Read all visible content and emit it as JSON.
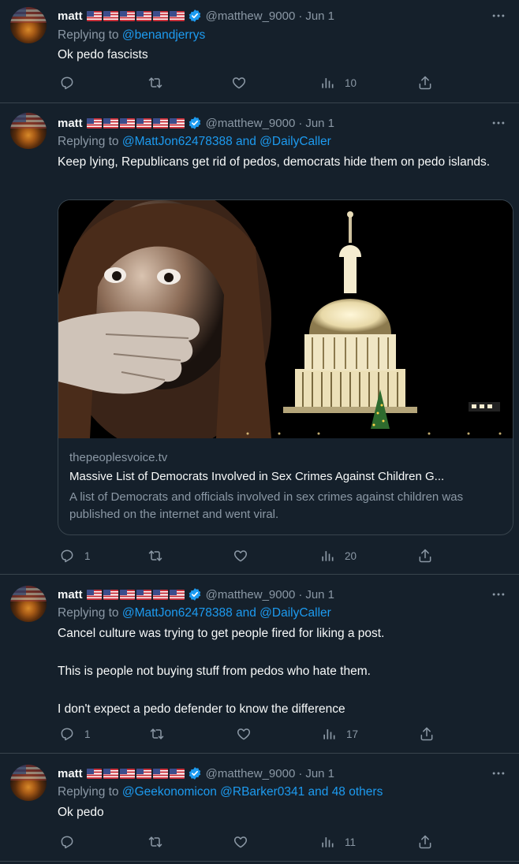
{
  "colors": {
    "background": "#15202b",
    "divider": "#38444d",
    "link": "#1d9bf0",
    "muted": "#8b98a5",
    "text": "#f7f9f9"
  },
  "icons": [
    "reply-icon",
    "retweet-icon",
    "like-icon",
    "views-icon",
    "share-icon",
    "verified-badge-icon",
    "more-icon"
  ],
  "tweets": [
    {
      "name": "matt",
      "handle": "@matthew_9000",
      "dot": "·",
      "date": "Jun 1",
      "reply_prefix": "Replying to ",
      "reply_to": "@benandjerrys",
      "text": "Ok pedo fascists",
      "reply_count": "",
      "views": "10"
    },
    {
      "name": "matt",
      "handle": "@matthew_9000",
      "dot": "·",
      "date": "Jun 1",
      "reply_prefix": "Replying to ",
      "reply_to": "@MattJon62478388 and @DailyCaller",
      "text": "Keep lying, Republicans get rid of pedos, democrats hide them on pedo islands.",
      "card": {
        "domain": "thepeoplesvoice.tv",
        "title": "Massive List of Democrats Involved in Sex Crimes Against Children G...",
        "description": "A list of Democrats and officials involved in sex crimes against children was published on the internet and went viral."
      },
      "reply_count": "1",
      "views": "20"
    },
    {
      "name": "matt",
      "handle": "@matthew_9000",
      "dot": "·",
      "date": "Jun 1",
      "reply_prefix": "Replying to ",
      "reply_to": "@MattJon62478388 and @DailyCaller",
      "text": "Cancel culture was trying to get people fired for liking a post.\n\nThis is people not buying stuff from pedos who hate them.\n\nI don't expect a pedo defender to know the difference",
      "reply_count": "1",
      "views": "17"
    },
    {
      "name": "matt",
      "handle": "@matthew_9000",
      "dot": "·",
      "date": "Jun 1",
      "reply_prefix": "Replying to ",
      "reply_to": "@Geekonomicon @RBarker0341 and 48 others",
      "text": "Ok pedo",
      "reply_count": "",
      "views": "11"
    }
  ]
}
